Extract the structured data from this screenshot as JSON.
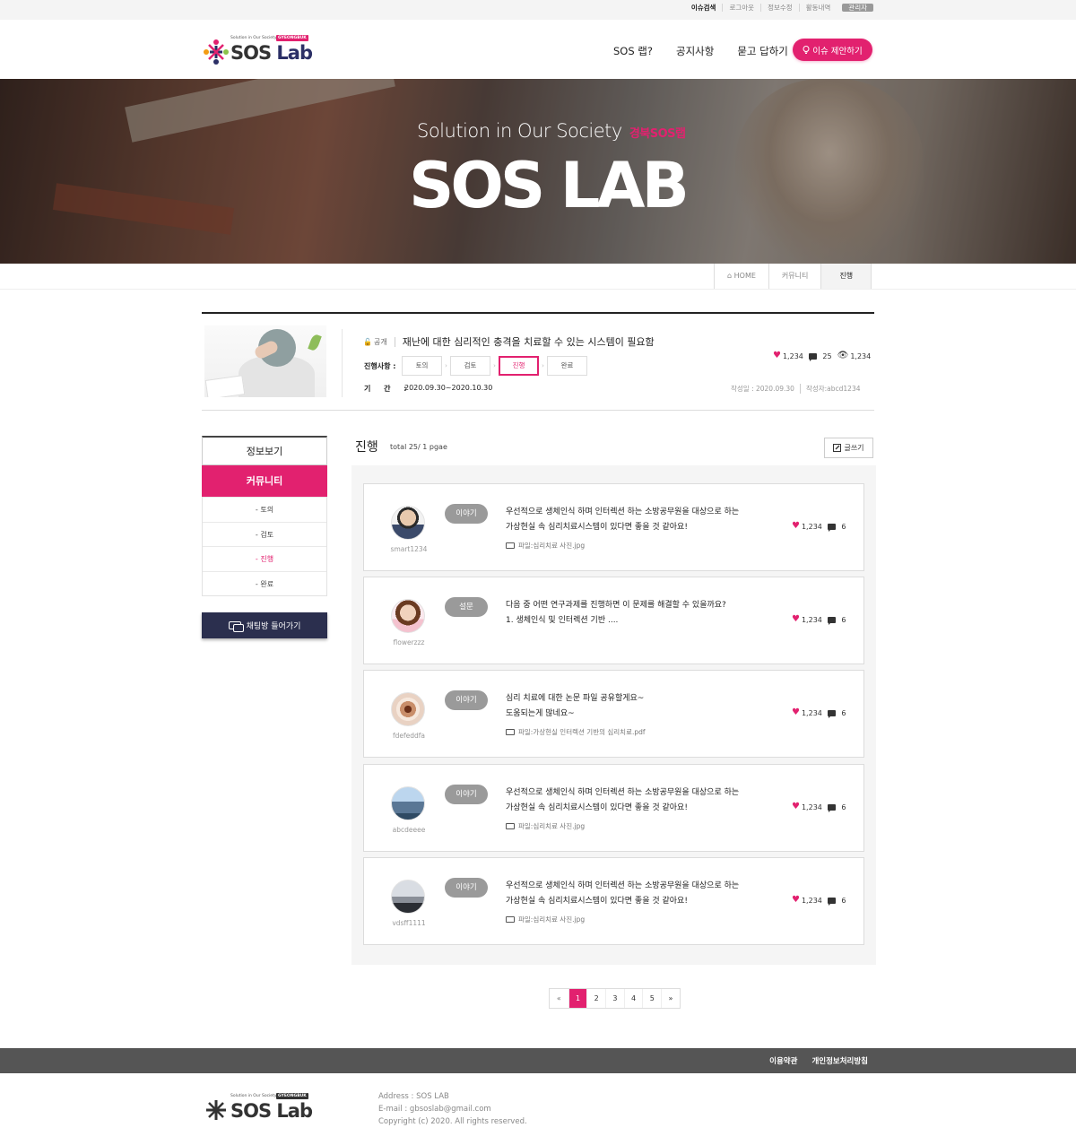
{
  "topbar": {
    "links": [
      "이슈검색",
      "로그아웃",
      "정보수정",
      "활동내역"
    ],
    "admin": "관리자"
  },
  "logo": {
    "tagline": "Solution in Our Society Lab",
    "badge": "GYEONGBUK",
    "word_sos": "SOS",
    "word_lab": "Lab"
  },
  "nav": [
    "SOS 랩?",
    "공지사항",
    "묻고 답하기"
  ],
  "suggest_button": "이슈 제안하기",
  "hero": {
    "subtitle": "Solution in Our Society",
    "subtitle_accent": "경북SOS랩",
    "title": "SOS LAB"
  },
  "breadcrumb": [
    "HOME",
    "커뮤니티",
    "진행"
  ],
  "issue": {
    "visibility": "공개",
    "title": "재난에 대한 심리적인 충격을 치료할 수 있는 시스템이 필요함",
    "likes": "1,234",
    "comments": "25",
    "views": "1,234",
    "progress_label": "진행사항 :",
    "steps": [
      "토의",
      "검토",
      "진행",
      "완료"
    ],
    "active_step": "진행",
    "period_label": "기 간 :",
    "period": "2020.09.30~2020.10.30",
    "created": "작성일 : 2020.09.30",
    "author": "작성자:abcd1234"
  },
  "sidebar": {
    "info": "정보보기",
    "community": "커뮤니티",
    "items": [
      "- 토의",
      "- 검토",
      "- 진행",
      "- 완료"
    ],
    "active_item": "- 진행",
    "chat_button": "채팅방 들어가기"
  },
  "list": {
    "title": "진행",
    "total": "total 25/ 1 pgae",
    "write_button": "글쓰기",
    "posts": [
      {
        "user": "smart1234",
        "tag": "이야기",
        "lines": [
          "우선적으로 생체인식 하며 인터렉션 하는 소방공무원을 대상으로 하는",
          "가상현실 속 심리치료시스템이 있다면 좋을 것 같아요!"
        ],
        "file": "파일:심리치료 사진.jpg",
        "likes": "1,234",
        "comments": "6"
      },
      {
        "user": "flowerzzz",
        "tag": "설문",
        "lines": [
          "다음 중 어떤 연구과제를 진행하면 이 문제를 해결할 수 있을까요?",
          "1. 생체인식 및 인터렉션 기반 ...."
        ],
        "file": "",
        "likes": "1,234",
        "comments": "6"
      },
      {
        "user": "fdefeddfa",
        "tag": "이야기",
        "lines": [
          "심리 치료에 대한 논문 파일 공유할게요~",
          "도움되는게 많네요~"
        ],
        "file": "파일:가상현실 인터렉션 기반의 심리치료.pdf",
        "likes": "1,234",
        "comments": "6"
      },
      {
        "user": "abcdeeee",
        "tag": "이야기",
        "lines": [
          "우선적으로 생체인식 하며 인터렉션 하는 소방공무원을 대상으로 하는",
          "가상현실 속 심리치료시스템이 있다면 좋을 것 같아요!"
        ],
        "file": "파일:심리치료 사진.jpg",
        "likes": "1,234",
        "comments": "6"
      },
      {
        "user": "vdsff1111",
        "tag": "이야기",
        "lines": [
          "우선적으로 생체인식 하며 인터렉션 하는 소방공무원을 대상으로 하는",
          "가상현실 속 심리치료시스템이 있다면 좋을 것 같아요!"
        ],
        "file": "파일:심리치료 사진.jpg",
        "likes": "1,234",
        "comments": "6"
      }
    ]
  },
  "pagination": {
    "prev": "«",
    "pages": [
      "1",
      "2",
      "3",
      "4",
      "5"
    ],
    "current": "1",
    "next": "»"
  },
  "footer": {
    "links": [
      "이용약관",
      "개인정보처리방침"
    ],
    "address": "Address : SOS LAB",
    "email": "E-mail : gbsoslab@gmail.com",
    "copyright": "Copyright (c) 2020. All rights reserved."
  },
  "colors": {
    "accent": "#e2216f",
    "navy": "#2b2f4e",
    "footer_bar": "#555555"
  }
}
